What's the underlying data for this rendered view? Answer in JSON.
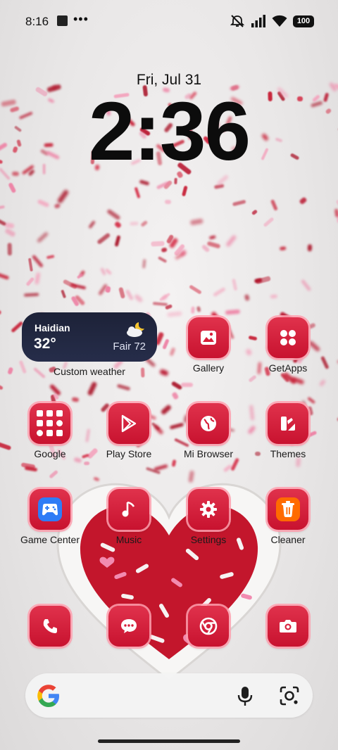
{
  "status_bar": {
    "time": "8:16",
    "dots": "•••",
    "battery": "100"
  },
  "lock": {
    "date": "Fri, Jul 31",
    "time": "2:36"
  },
  "weather_widget": {
    "city": "Haidian",
    "temperature": "32°",
    "condition": "Fair 72",
    "label": "Custom weather"
  },
  "apps": {
    "gallery": "Gallery",
    "getapps": "GetApps",
    "google": "Google",
    "play_store": "Play Store",
    "mi_browser": "Mi Browser",
    "themes": "Themes",
    "game_center": "Game Center",
    "music": "Music",
    "settings": "Settings",
    "cleaner": "Cleaner"
  },
  "dock": [
    "phone-icon",
    "messages-icon",
    "chrome-icon",
    "camera-icon"
  ],
  "colors": {
    "icon_red": "#d61f3a",
    "widget_navy": "#1d2238"
  }
}
